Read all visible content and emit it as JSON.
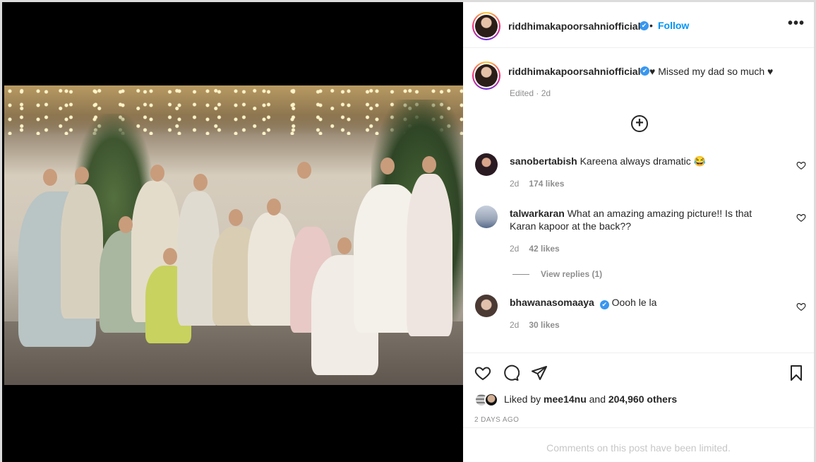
{
  "post": {
    "username": "riddhimakapoorsahniofficial",
    "verified_glyph": "✔",
    "separator": "•",
    "follow_label": "Follow",
    "more_glyph": "•••",
    "caption": "♥ Missed my dad so much ♥",
    "caption_meta": "Edited · 2d",
    "load_more_glyph": "+"
  },
  "comments": [
    {
      "user": "sanobertabish",
      "text": "Kareena always dramatic 😂",
      "time": "2d",
      "likes": "174 likes",
      "verified": false
    },
    {
      "user": "talwarkaran",
      "text": "What an amazing amazing picture!! Is that Karan kapoor at the back??",
      "time": "2d",
      "likes": "42 likes",
      "verified": false
    },
    {
      "user": "bhawanasomaaya",
      "text": "Oooh le la",
      "time": "2d",
      "likes": "30 likes",
      "verified": true
    }
  ],
  "view_replies": "View replies (1)",
  "likes": {
    "prefix": "Liked by",
    "user": "mee14nu",
    "middle": "and",
    "count": "204,960 others"
  },
  "timestamp": "2 DAYS AGO",
  "comments_limited": "Comments on this post have been limited.",
  "icons": [
    "verified-badge-icon",
    "more-options-icon",
    "load-more-comments-icon",
    "heart-icon",
    "comment-icon",
    "share-icon",
    "bookmark-icon"
  ],
  "colors": {
    "accent": "#0095f6",
    "verified": "#3897f0",
    "meta": "#8e8e8e",
    "limited": "#c7c7c7"
  }
}
